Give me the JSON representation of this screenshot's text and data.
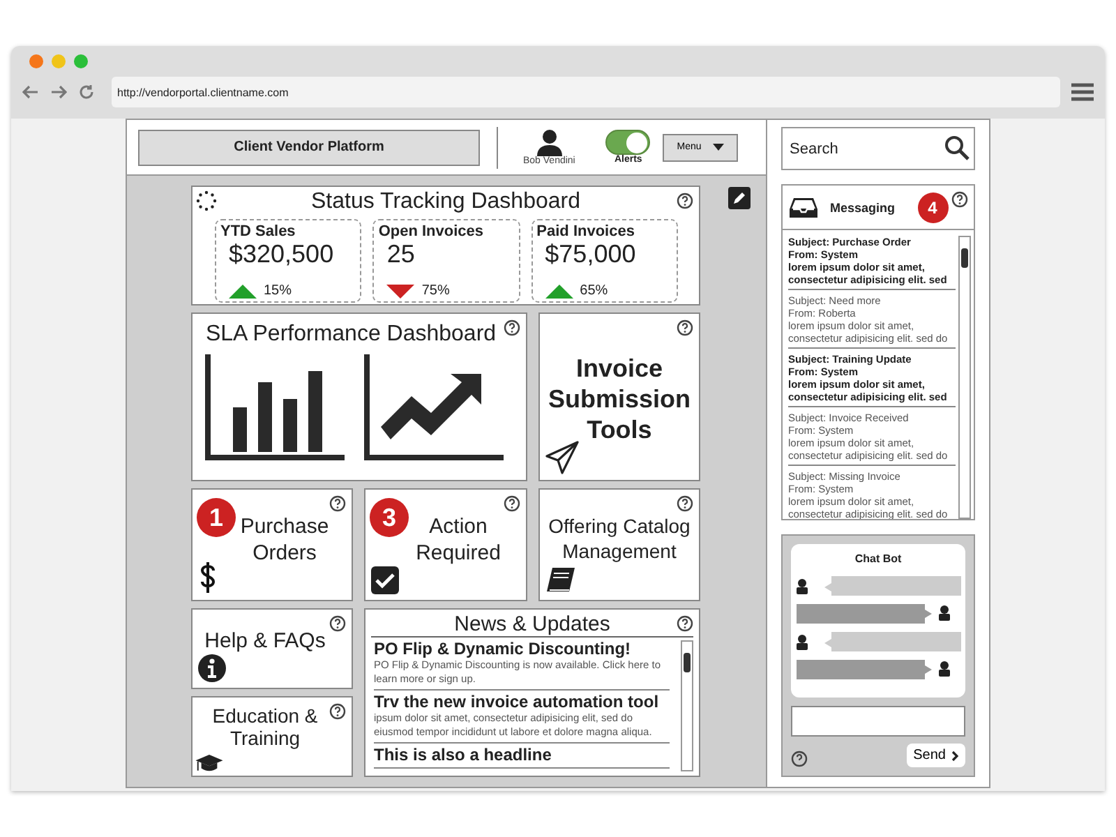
{
  "browser": {
    "url": "http://vendorportal.clientname.com"
  },
  "header": {
    "title": "Client Vendor Platform",
    "user": "Bob Vendini",
    "alerts": {
      "label": "Alerts",
      "on": true
    },
    "menu": "Menu"
  },
  "status": {
    "title": "Status Tracking Dashboard",
    "stats": [
      {
        "label": "YTD Sales",
        "value": "$320,500",
        "rising": true,
        "change": "15%"
      },
      {
        "label": "Open Invoices",
        "value": "25",
        "rising": false,
        "change": "75%"
      },
      {
        "label": "Paid Invoices",
        "value": "$75,000",
        "rising": true,
        "change": "65%"
      }
    ]
  },
  "sla": {
    "title": "SLA Performance Dashboard"
  },
  "invoice_tools": {
    "title": "Invoice Submission Tools"
  },
  "tiles": [
    {
      "kind": "orders",
      "badge": "1",
      "title": "Purchase Orders"
    },
    {
      "kind": "action",
      "badge": "3",
      "title": "Action Required"
    },
    {
      "kind": "catalog",
      "title": "Offering Catalog Management"
    }
  ],
  "help": {
    "title": "Help & FAQs"
  },
  "education": {
    "title": "Education & Training"
  },
  "news": {
    "title": "News & Updates",
    "items": [
      {
        "headline": "PO Flip & Dynamic Discounting!",
        "body": "PO Flip & Dynamic Discounting is now available. Click here to learn more or sign up."
      },
      {
        "headline": "Trv the new invoice automation tool",
        "body": "ipsum dolor sit amet, consectetur adipisicing elit, sed do eiusmod tempor incididunt ut labore et dolore magna aliqua."
      },
      {
        "headline": "This is also a headline"
      }
    ]
  },
  "search": {
    "placeholder": "Search"
  },
  "messaging": {
    "title": "Messaging",
    "badge": "4",
    "messages": [
      {
        "unread": true,
        "subject": "Subject: Purchase Order",
        "from": "From: System",
        "body": "lorem ipsum dolor sit amet, consectetur adipisicing elit. sed"
      },
      {
        "unread": false,
        "subject": "Subject: Need more",
        "from": "From: Roberta",
        "body": "lorem ipsum dolor sit amet, consectetur adipisicing elit. sed do"
      },
      {
        "unread": true,
        "subject": "Subject: Training Update",
        "from": "From: System",
        "body": "lorem ipsum dolor sit amet, consectetur adipisicing elit. sed"
      },
      {
        "unread": false,
        "subject": "Subject: Invoice Received",
        "from": "From: System",
        "body": "lorem ipsum dolor sit amet, consectetur adipisicing elit. sed do"
      },
      {
        "unread": false,
        "subject": "Subject: Missing Invoice",
        "from": "From: System",
        "body": "lorem ipsum dolor sit amet, consectetur adipisicing elit. sed do"
      }
    ]
  },
  "chat": {
    "title": "Chat Bot",
    "send": "Send"
  }
}
